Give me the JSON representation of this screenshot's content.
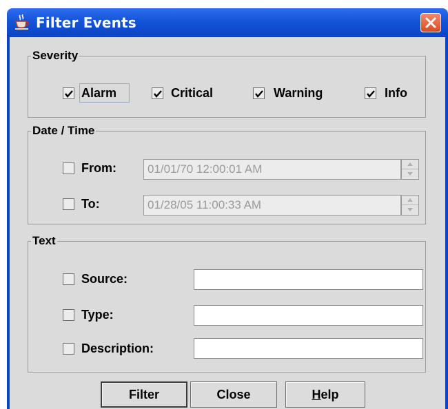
{
  "window": {
    "title": "Filter Events",
    "icon": "java-coffee-icon",
    "close_icon": "close-x-icon"
  },
  "severity": {
    "legend": "Severity",
    "items": [
      {
        "label": "Alarm",
        "checked": true
      },
      {
        "label": "Critical",
        "checked": true
      },
      {
        "label": "Warning",
        "checked": true
      },
      {
        "label": "Info",
        "checked": true
      }
    ]
  },
  "datetime": {
    "legend": "Date / Time",
    "from": {
      "label": "From:",
      "checked": false,
      "value": "01/01/70 12:00:01 AM"
    },
    "to": {
      "label": "To:",
      "checked": false,
      "value": "01/28/05 11:00:33 AM"
    }
  },
  "text": {
    "legend": "Text",
    "source": {
      "label": "Source:",
      "checked": false,
      "value": ""
    },
    "type": {
      "label": "Type:",
      "checked": false,
      "value": ""
    },
    "description": {
      "label": "Description:",
      "checked": false,
      "value": ""
    }
  },
  "buttons": {
    "filter": "Filter",
    "close": "Close",
    "help_mnemonic": "H",
    "help_rest": "elp"
  },
  "colors": {
    "titlebar": "#1553d6",
    "client_bg": "#dbdbdb",
    "close_button": "#d94a22"
  }
}
